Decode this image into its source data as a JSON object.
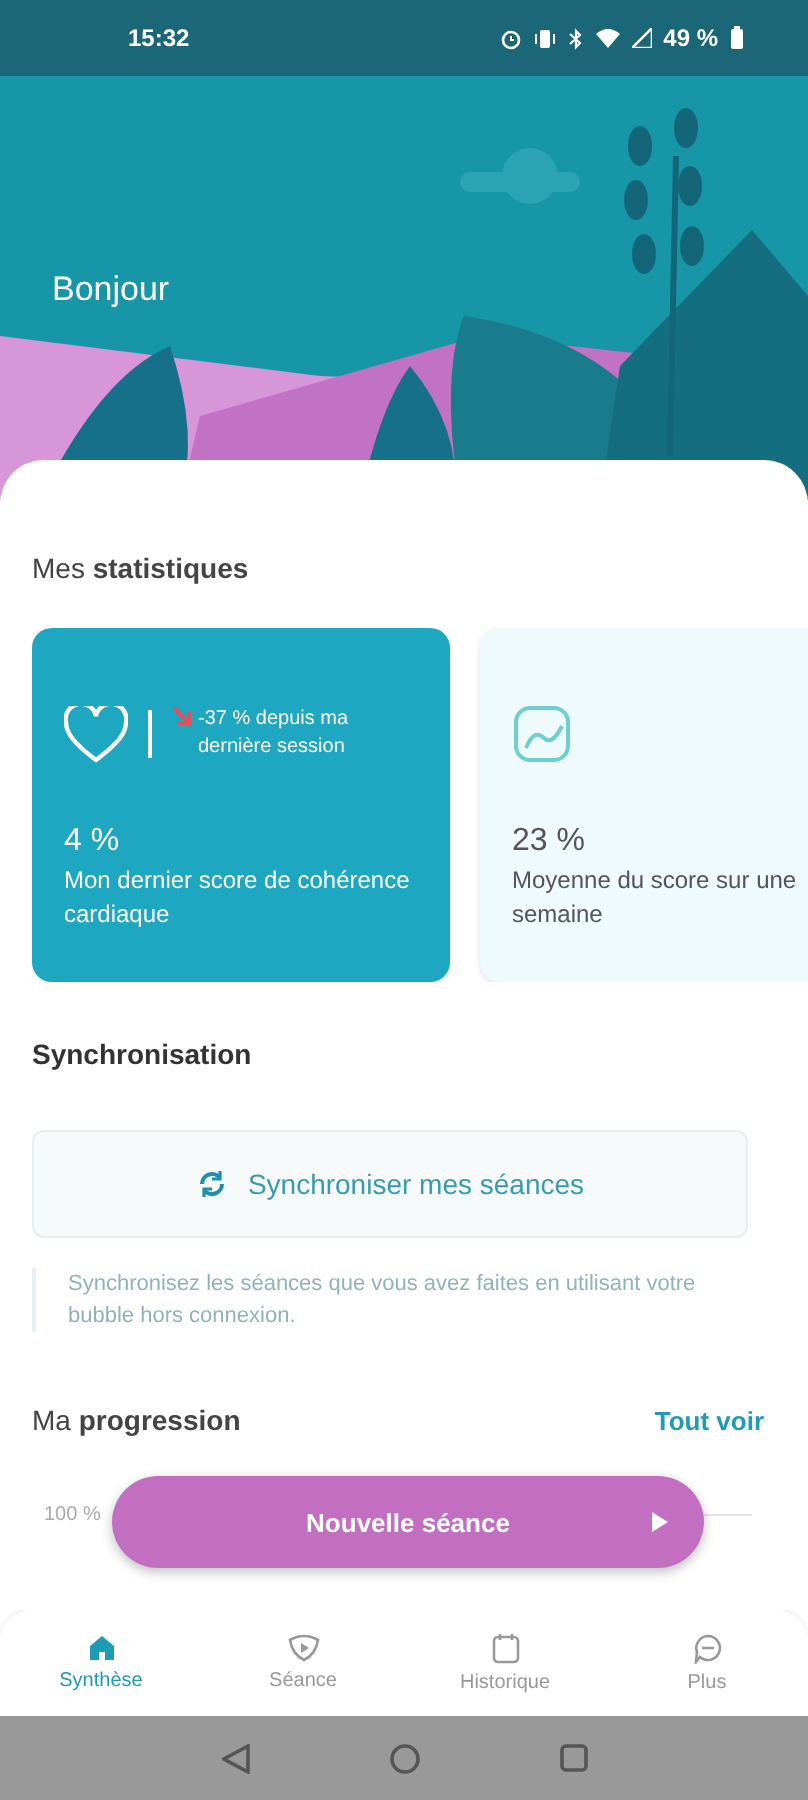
{
  "status_bar": {
    "time": "15:32",
    "battery": "49 %"
  },
  "greeting": "Bonjour",
  "stats": {
    "title": "Mes **statistiques**",
    "cards": [
      {
        "kind": "highlight",
        "value": "4 %",
        "label": "Mon dernier score de cohérence cardiaque",
        "trend": "-37 % depuis ma dernière session"
      },
      {
        "kind": "plain",
        "value": "23 %",
        "label": "Moyenne du score sur une semaine"
      }
    ]
  },
  "sync": {
    "title": "Synchronisation",
    "button": "Synchroniser mes séances",
    "note": "Synchronisez les séances que vous avez faites en utilisant votre bubble hors connexion."
  },
  "progression": {
    "title": "Ma **progression**",
    "link": "Tout voir",
    "axis_label": "100 %"
  },
  "fab": {
    "label": "Nouvelle séance"
  },
  "tabs": [
    {
      "label": "Synthèse",
      "selected": true
    },
    {
      "label": "Séance",
      "selected": false
    },
    {
      "label": "Historique",
      "selected": false
    },
    {
      "label": "Plus",
      "selected": false
    }
  ]
}
